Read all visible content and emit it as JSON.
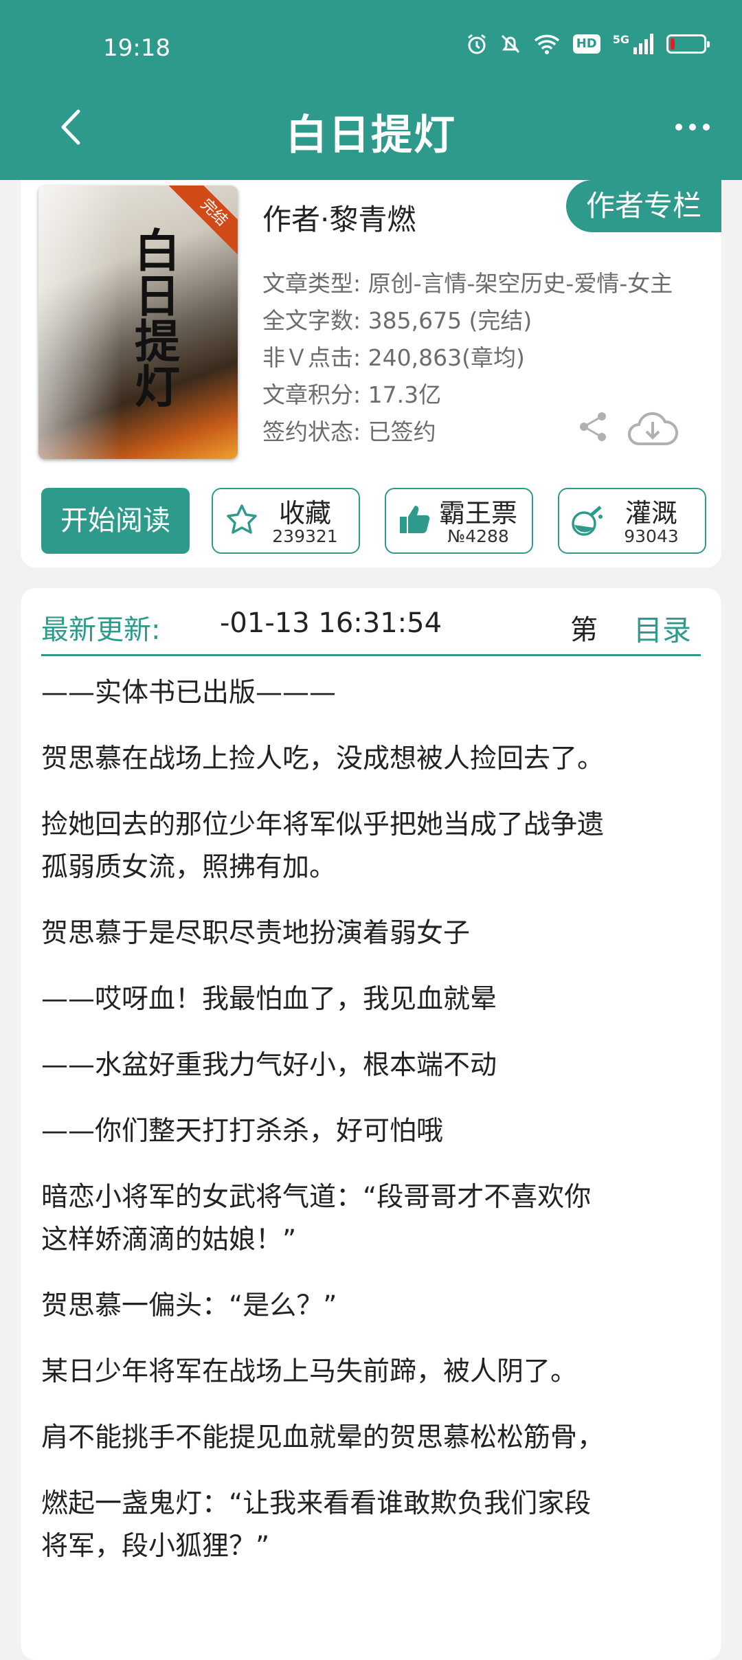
{
  "status_bar": {
    "time": "19:18",
    "hd": "HD",
    "network": "5G"
  },
  "header": {
    "title": "白日提灯"
  },
  "book": {
    "cover_badge": "完结",
    "cover_title": "白日提灯",
    "author": "作者·黎青燃",
    "author_column_label": "作者专栏",
    "meta": [
      "文章类型: 原创-言情-架空历史-爱情-女主",
      "全文字数: 385,675 (完结)",
      "非Ｖ点击: 240,863(章均)",
      "文章积分: 17.3亿",
      "签约状态: 已签约"
    ]
  },
  "actions": {
    "read_label": "开始阅读",
    "favorite": {
      "label": "收藏",
      "count": "239321"
    },
    "vote": {
      "label": "霸王票",
      "count": "№4288"
    },
    "water": {
      "label": "灌溉",
      "count": "93043"
    }
  },
  "update": {
    "label": "最新更新:",
    "time": "-01-13 16:31:54",
    "chapter": "第",
    "toc_label": "目录"
  },
  "description": [
    "——实体书已出版———",
    "贺思慕在战场上捡人吃，没成想被人捡回去了。",
    "捡她回去的那位少年将军似乎把她当成了战争遗",
    "孤弱质女流，照拂有加。",
    "贺思慕于是尽职尽责地扮演着弱女子",
    "——哎呀血！我最怕血了，我见血就晕",
    "——水盆好重我力气好小，根本端不动",
    "——你们整天打打杀杀，好可怕哦",
    "暗恋小将军的女武将气道：“段哥哥才不喜欢你",
    "这样娇滴滴的姑娘！”",
    "贺思慕一偏头：“是么？”",
    "某日少年将军在战场上马失前蹄，被人阴了。",
    "肩不能挑手不能提见血就晕的贺思慕松松筋骨，",
    "燃起一盏鬼灯：“让我来看看谁敢欺负我们家段",
    "将军，段小狐狸？”"
  ],
  "colors": {
    "accent": "#2e9a8c",
    "battery_low": "#e02020"
  }
}
